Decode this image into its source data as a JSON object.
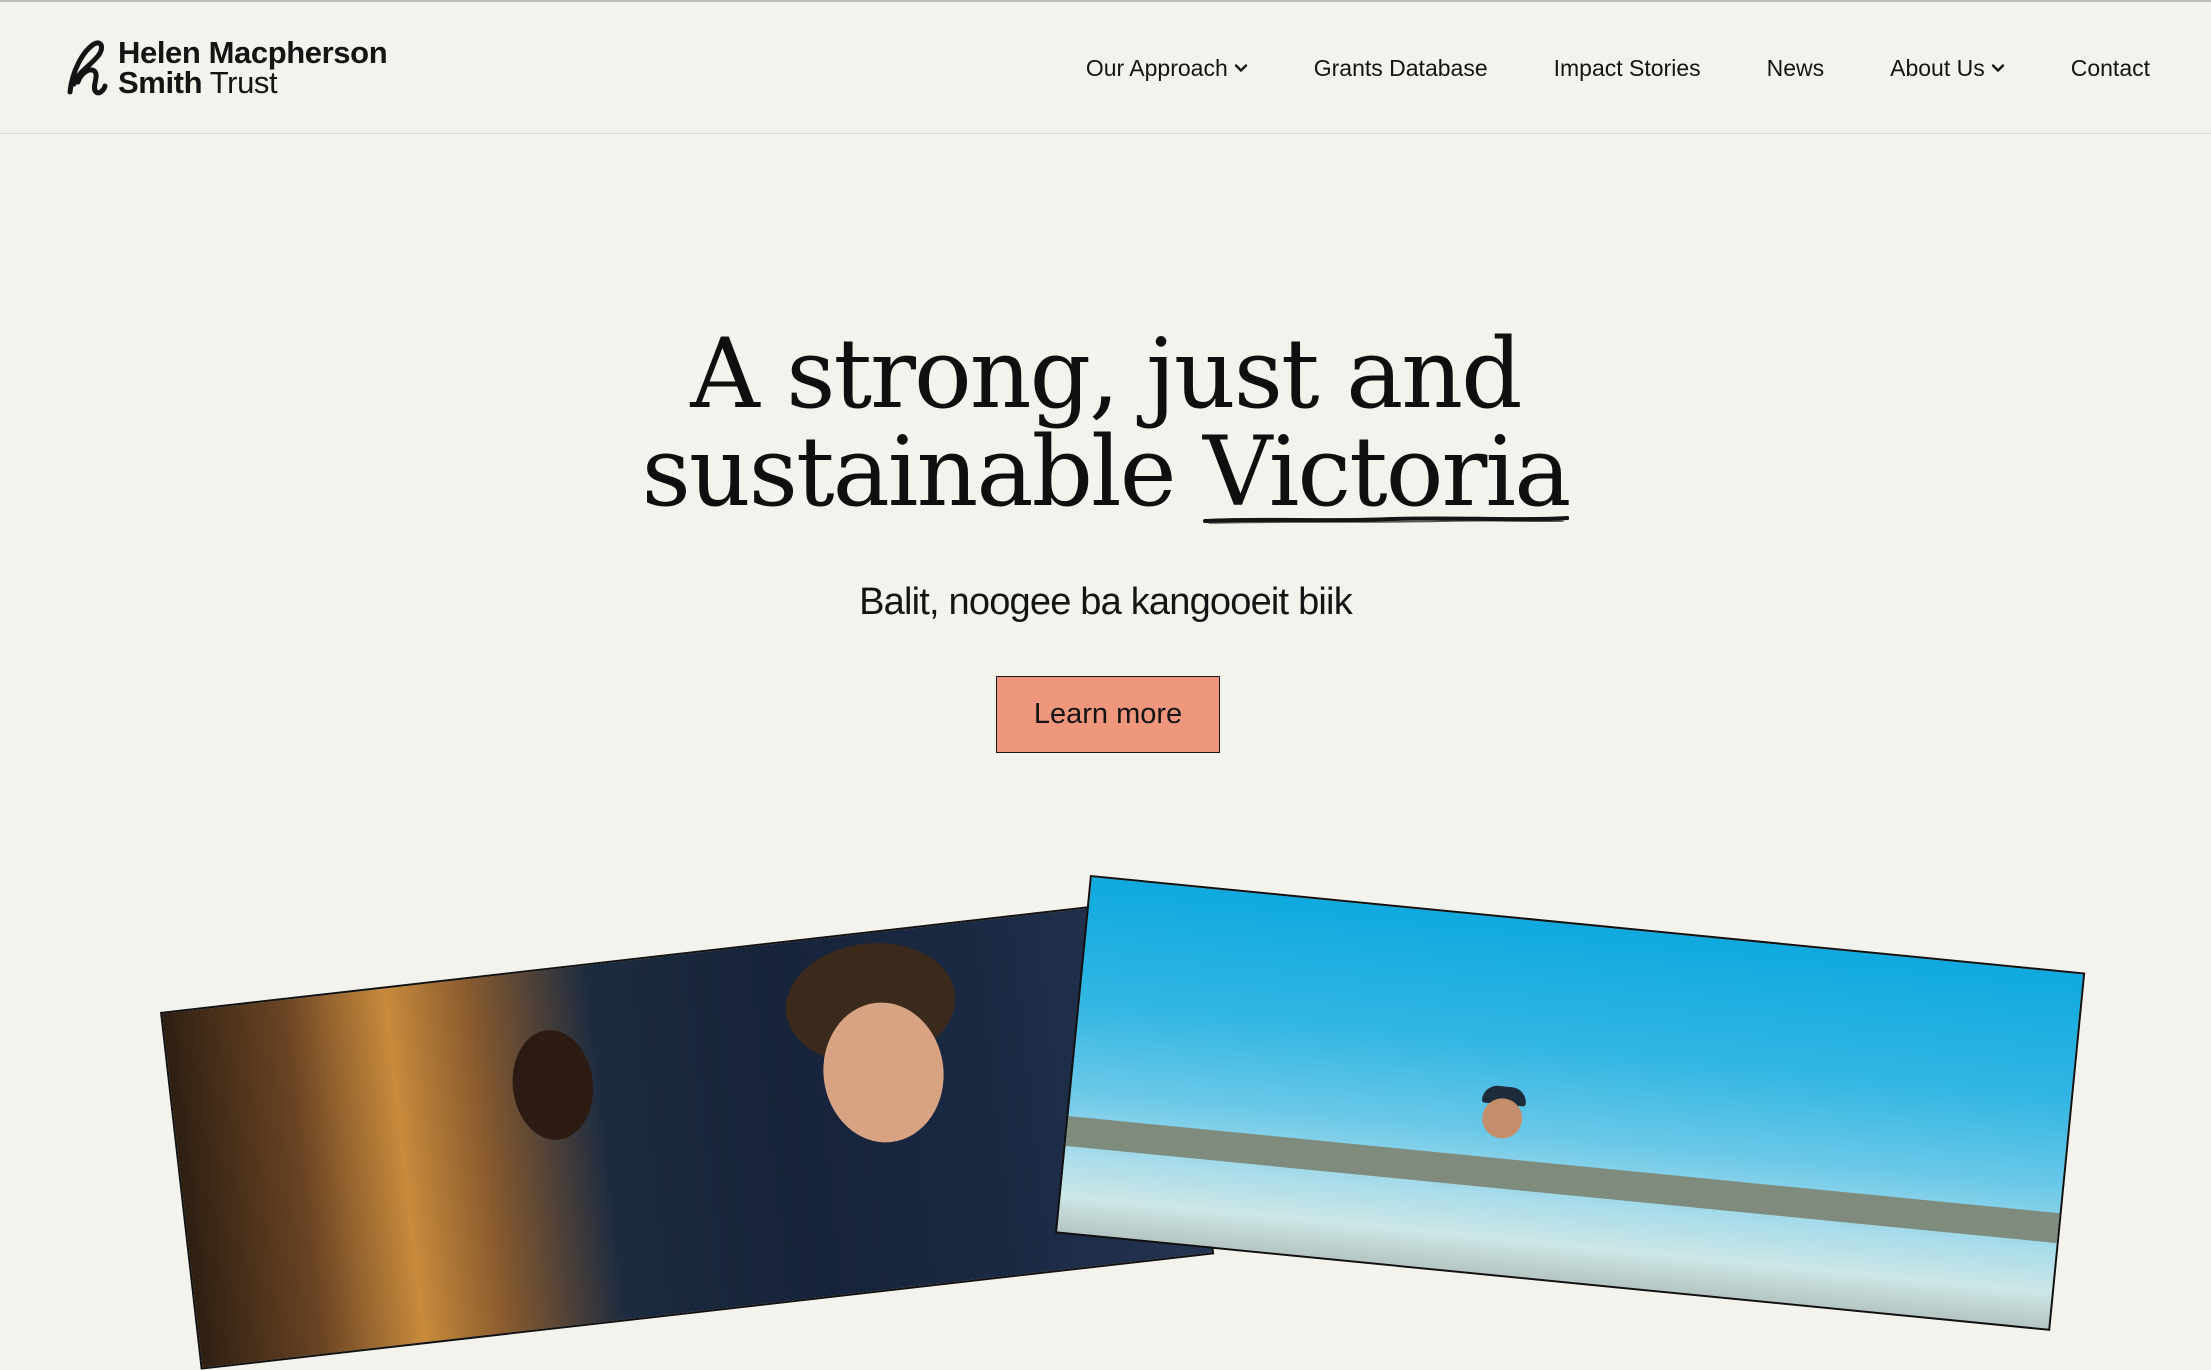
{
  "brand": {
    "line1": "Helen Macpherson",
    "line2_strong": "Smith",
    "line2_light": "Trust"
  },
  "nav": {
    "items": [
      {
        "label": "Our Approach",
        "has_dropdown": true
      },
      {
        "label": "Grants Database",
        "has_dropdown": false
      },
      {
        "label": "Impact Stories",
        "has_dropdown": false
      },
      {
        "label": "News",
        "has_dropdown": false
      },
      {
        "label": "About Us",
        "has_dropdown": true
      },
      {
        "label": "Contact",
        "has_dropdown": false
      }
    ]
  },
  "hero": {
    "title_line1": "A strong, just and",
    "title_line2_prefix": "sustainable ",
    "title_line2_highlight": "Victoria",
    "subtitle": "Balit, noogee ba kangooeit biik",
    "cta_label": "Learn more"
  },
  "colors": {
    "background": "#f3f2ec",
    "cta": "#ee977c",
    "text": "#141414"
  },
  "icons": {
    "logo": "hms-logo-icon",
    "dropdown": "chevron-down-icon"
  }
}
